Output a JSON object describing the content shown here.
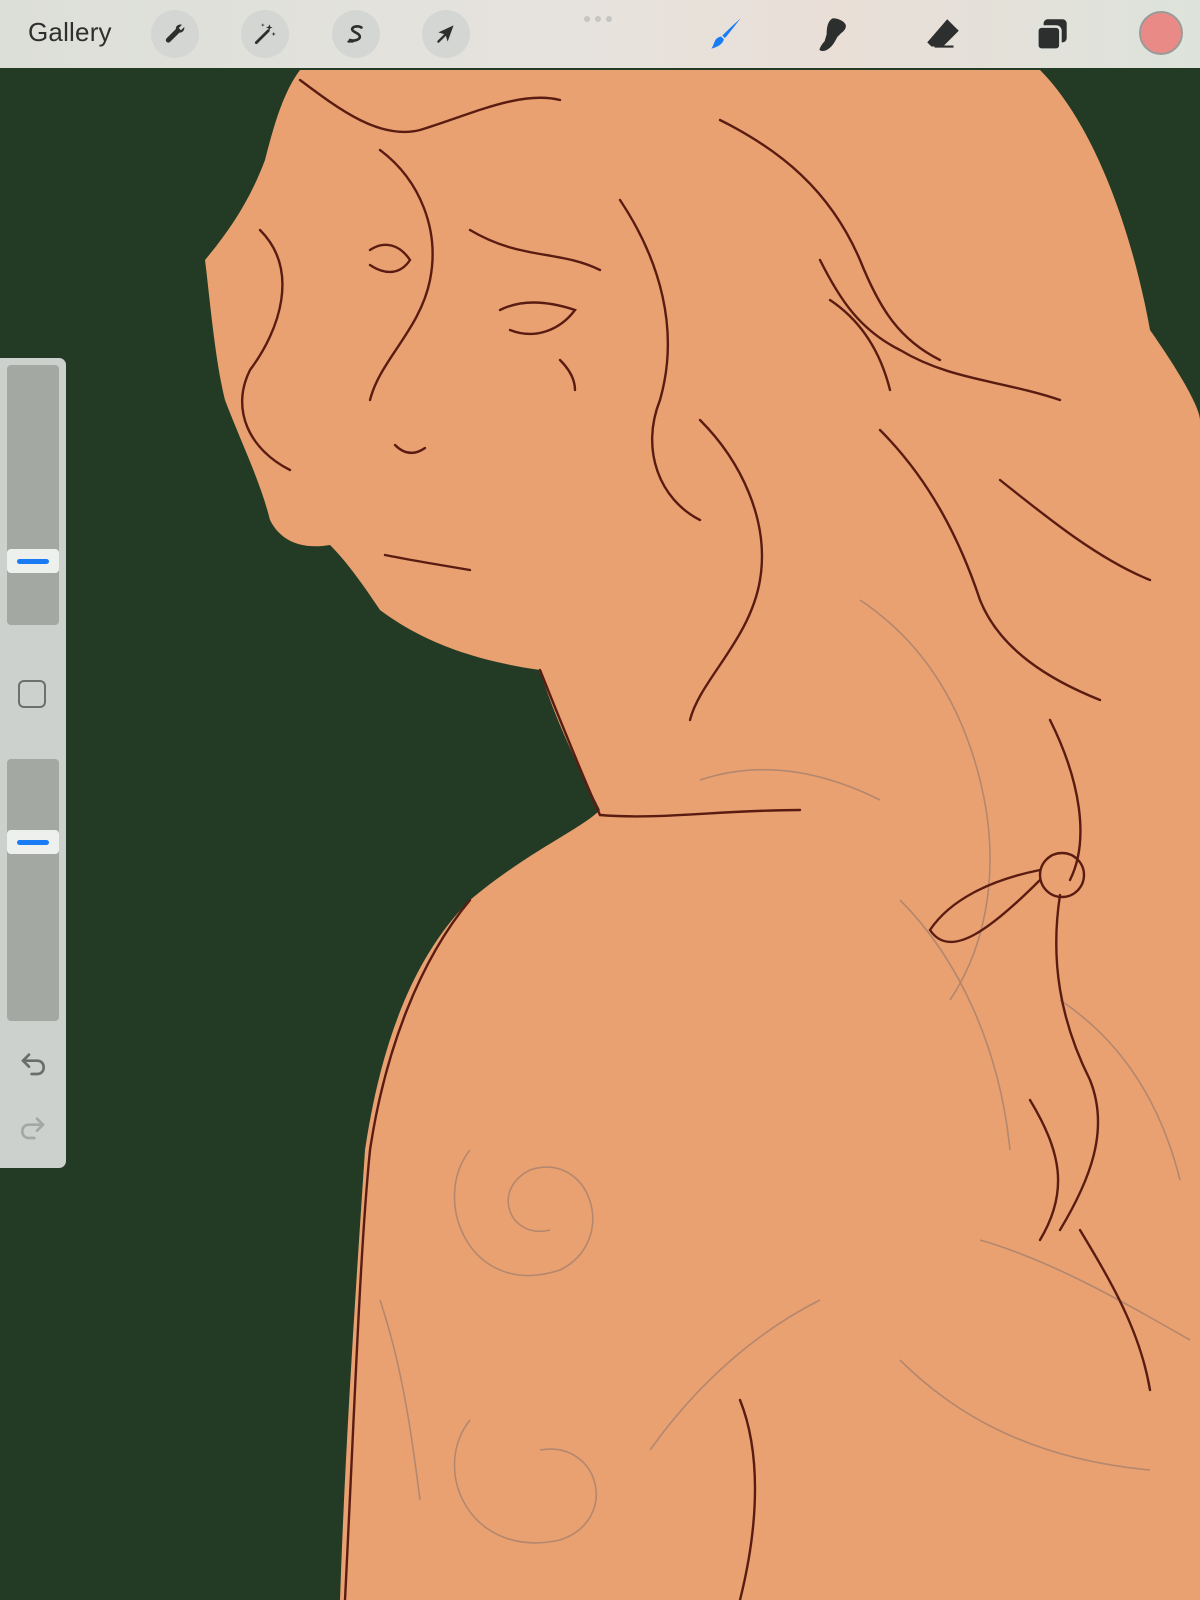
{
  "toolbar": {
    "gallery_label": "Gallery",
    "left_tools": [
      {
        "name": "actions",
        "icon": "wrench-icon"
      },
      {
        "name": "adjustments",
        "icon": "magic-wand-icon"
      },
      {
        "name": "selection",
        "icon": "selection-s-icon"
      },
      {
        "name": "transform",
        "icon": "arrow-cursor-icon"
      }
    ],
    "right_tools": [
      {
        "name": "brush",
        "icon": "brush-icon",
        "active": true
      },
      {
        "name": "smudge",
        "icon": "smudge-icon",
        "active": false
      },
      {
        "name": "eraser",
        "icon": "eraser-icon",
        "active": false
      },
      {
        "name": "layers",
        "icon": "layers-icon",
        "active": false
      }
    ],
    "active_color": "#e98a86",
    "accent_color": "#1a7cf5"
  },
  "sidebar": {
    "brush_size_level": 0.22,
    "opacity_level": 0.7,
    "modify_icon": "square-modify-icon",
    "undo_icon": "undo-icon",
    "redo_icon": "redo-icon"
  },
  "canvas": {
    "background_color": "#233b24",
    "skin_color": "#e9a171",
    "line_color": "#5a1c12",
    "sketch_color": "#a27f6e"
  }
}
